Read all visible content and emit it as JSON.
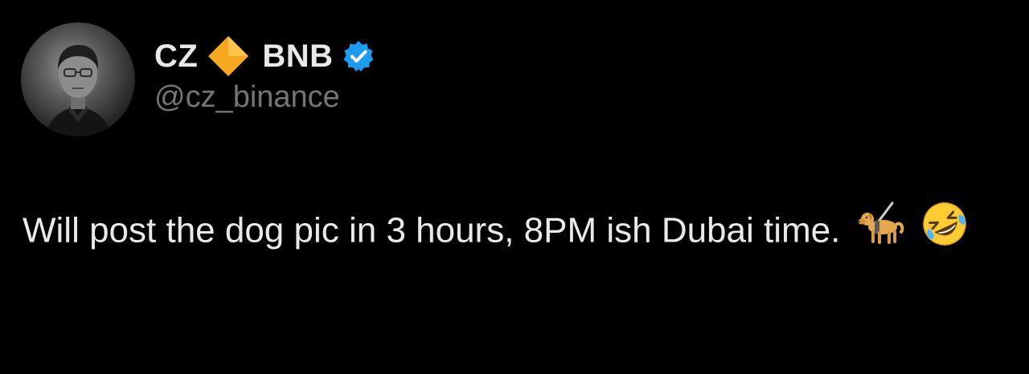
{
  "author": {
    "name_first": "CZ",
    "name_second": "BNB",
    "handle": "@cz_binance",
    "icons": [
      "orange-diamond-icon",
      "verified-badge-icon"
    ],
    "verified_color": "#1d9bf0",
    "diamond_color": "#f6a821"
  },
  "tweet": {
    "text": "Will post the dog pic in 3 hours, 8PM ish Dubai time.",
    "emojis": [
      "guide-dog-emoji",
      "rolling-on-floor-laughing-emoji"
    ]
  },
  "theme": {
    "background": "#000000",
    "text_color": "#e7e9ea",
    "secondary_text_color": "#71767b"
  }
}
